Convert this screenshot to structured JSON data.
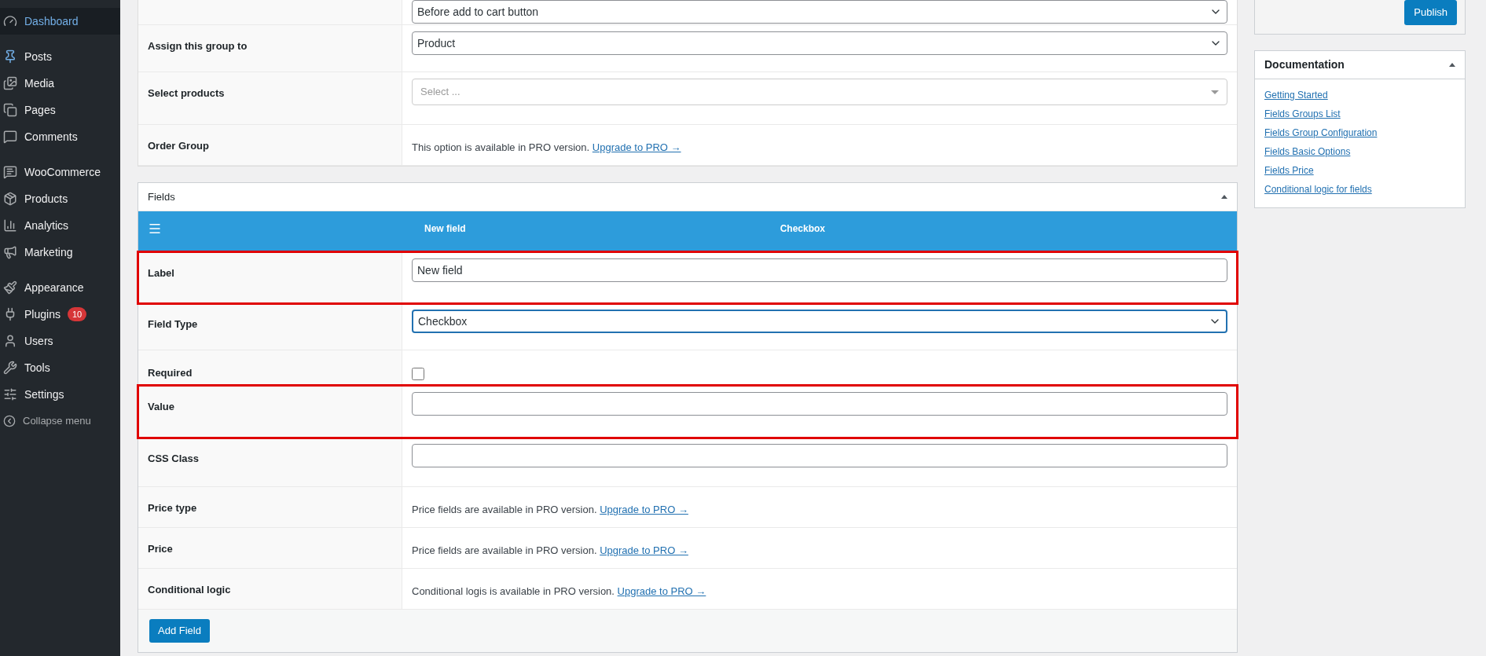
{
  "sidebar": {
    "groups": [
      [
        {
          "label": "Dashboard",
          "selected": true
        }
      ],
      [
        {
          "label": "Posts",
          "selected": false
        },
        {
          "label": "Media",
          "selected": false
        },
        {
          "label": "Pages",
          "selected": false
        },
        {
          "label": "Comments",
          "selected": false
        }
      ],
      [
        {
          "label": "WooCommerce",
          "selected": false
        },
        {
          "label": "Products",
          "selected": false
        },
        {
          "label": "Analytics",
          "selected": false
        },
        {
          "label": "Marketing",
          "selected": false
        }
      ],
      [
        {
          "label": "Appearance",
          "selected": false
        },
        {
          "label": "Plugins",
          "selected": false,
          "badge": "10"
        },
        {
          "label": "Users",
          "selected": false
        },
        {
          "label": "Tools",
          "selected": false
        },
        {
          "label": "Settings",
          "selected": false
        }
      ]
    ],
    "collapse": "Collapse menu"
  },
  "group_settings": {
    "rows": [
      {
        "kind": "select",
        "label": "",
        "value": "Before add to cart button"
      },
      {
        "kind": "select",
        "label": "Assign this group to",
        "value": "Product"
      },
      {
        "kind": "multiselect",
        "label": "Select products",
        "placeholder": "Select ..."
      },
      {
        "kind": "pro",
        "label": "Order Group",
        "text": "This option is available in PRO version.",
        "link": "Upgrade to PRO →"
      }
    ]
  },
  "fields": {
    "title": "Fields",
    "header": {
      "name": "New field",
      "type": "Checkbox"
    },
    "rows": [
      {
        "kind": "text",
        "label": "Label",
        "value": "New field",
        "highlighted": true
      },
      {
        "kind": "select",
        "label": "Field Type",
        "value": "Checkbox",
        "focused": true,
        "highlighted": false
      },
      {
        "kind": "checkbox",
        "label": "Required",
        "checked": false,
        "highlighted": false
      },
      {
        "kind": "text",
        "label": "Value",
        "value": "",
        "highlighted": true
      },
      {
        "kind": "text",
        "label": "CSS Class",
        "value": "",
        "highlighted": false
      },
      {
        "kind": "pro",
        "label": "Price type",
        "text": "Price fields are available in PRO version.",
        "link": "Upgrade to PRO →",
        "highlighted": false
      },
      {
        "kind": "pro",
        "label": "Price",
        "text": "Price fields are available in PRO version.",
        "link": "Upgrade to PRO →",
        "highlighted": false
      },
      {
        "kind": "pro",
        "label": "Conditional logic",
        "text": "Conditional logis is available in PRO version.",
        "link": "Upgrade to PRO →",
        "highlighted": false
      }
    ],
    "add_button": "Add Field"
  },
  "publish": {
    "button": "Publish"
  },
  "documentation": {
    "title": "Documentation",
    "links": [
      "Getting Started",
      "Fields Groups List",
      "Fields Group Configuration",
      "Fields Basic Options",
      "Fields Price",
      "Conditional logic for fields"
    ]
  }
}
